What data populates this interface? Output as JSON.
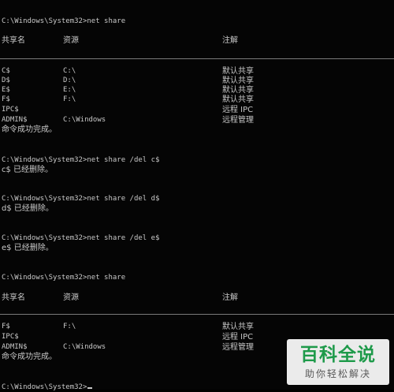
{
  "terminal": {
    "commands": {
      "share1": "C:\\Windows\\System32>net share",
      "del_c": "C:\\Windows\\System32>net share /del c$",
      "del_d": "C:\\Windows\\System32>net share /del d$",
      "del_e": "C:\\Windows\\System32>net share /del e$",
      "share2": "C:\\Windows\\System32>net share",
      "prompt": "C:\\Windows\\System32>"
    },
    "headers": {
      "share_name": "共享名",
      "resource": "资源",
      "remark": "注解"
    },
    "table1": [
      {
        "name": "C$",
        "resource": "C:\\",
        "remark": "默认共享"
      },
      {
        "name": "D$",
        "resource": "D:\\",
        "remark": "默认共享"
      },
      {
        "name": "E$",
        "resource": "E:\\",
        "remark": "默认共享"
      },
      {
        "name": "F$",
        "resource": "F:\\",
        "remark": "默认共享"
      },
      {
        "name": "IPC$",
        "resource": "",
        "remark": "远程 IPC"
      },
      {
        "name": "ADMIN$",
        "resource": "C:\\Windows",
        "remark": "远程管理"
      }
    ],
    "table2": [
      {
        "name": "F$",
        "resource": "F:\\",
        "remark": "默认共享"
      },
      {
        "name": "IPC$",
        "resource": "",
        "remark": "远程 IPC"
      },
      {
        "name": "ADMIN$",
        "resource": "C:\\Windows",
        "remark": "远程管理"
      }
    ],
    "outputs": {
      "success1": "命令成功完成。",
      "deleted_c": "c$ 已经删除。",
      "deleted_d": "d$ 已经删除。",
      "deleted_e": "e$ 已经删除。",
      "success2": "命令成功完成。"
    }
  },
  "watermark": {
    "title": "百科全说",
    "subtitle": "助你轻松解决"
  },
  "colors": {
    "background": "#050505",
    "text": "#c8c8c8",
    "watermark_green": "#1e9a4a"
  }
}
